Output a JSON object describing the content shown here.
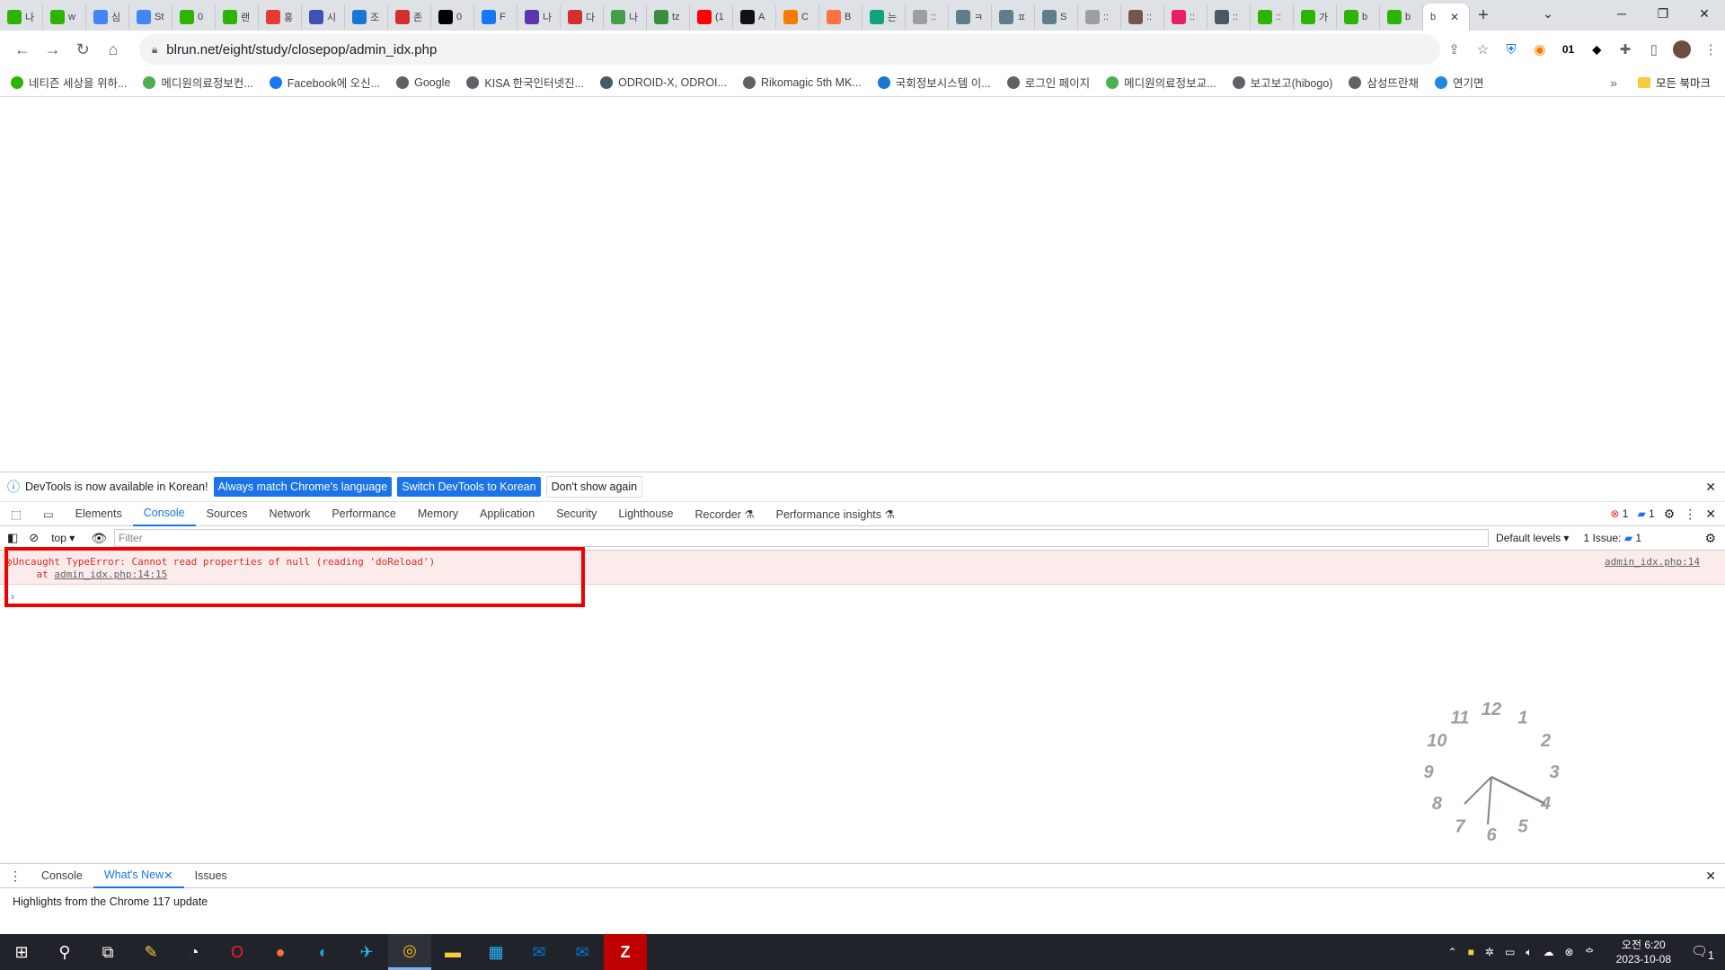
{
  "tabs": [
    {
      "label": "나",
      "icon": "naver-leaf-icon",
      "color": "#2db400"
    },
    {
      "label": "w",
      "icon": "naver-leaf-icon",
      "color": "#2db400"
    },
    {
      "label": "심",
      "icon": "globe-icon",
      "color": "#4285f4"
    },
    {
      "label": "St",
      "icon": "globe-icon",
      "color": "#4285f4"
    },
    {
      "label": "0",
      "icon": "naver-leaf-icon",
      "color": "#2db400"
    },
    {
      "label": "랜",
      "icon": "naver-leaf-icon",
      "color": "#2db400"
    },
    {
      "label": "홍",
      "icon": "n-icon",
      "color": "#e53935"
    },
    {
      "label": "시",
      "icon": "z-icon",
      "color": "#3f51b5"
    },
    {
      "label": "조",
      "icon": "cross-icon",
      "color": "#1976d2"
    },
    {
      "label": "존",
      "icon": "swirl-icon",
      "color": "#d32f2f"
    },
    {
      "label": "0",
      "icon": "x-icon",
      "color": "#000000"
    },
    {
      "label": "F",
      "icon": "facebook-icon",
      "color": "#1877f2"
    },
    {
      "label": "나",
      "icon": "circle-icon",
      "color": "#5e35b1"
    },
    {
      "label": "다",
      "icon": "t-icon",
      "color": "#d32f2f"
    },
    {
      "label": "나",
      "icon": "check-icon",
      "color": "#43a047"
    },
    {
      "label": "tz",
      "icon": "leaf-icon",
      "color": "#388e3c"
    },
    {
      "label": "(1",
      "icon": "youtube-icon",
      "color": "#ff0000"
    },
    {
      "label": "A",
      "icon": "amazon-icon",
      "color": "#111111"
    },
    {
      "label": "C",
      "icon": "cube-icon",
      "color": "#f57c00"
    },
    {
      "label": "B",
      "icon": "b-icon",
      "color": "#ff7043"
    },
    {
      "label": "는",
      "icon": "chatgpt-icon",
      "color": "#10a37f"
    },
    {
      "label": "::",
      "icon": "c-icon",
      "color": "#9e9e9e"
    },
    {
      "label": "ㅋ",
      "icon": "c-icon",
      "color": "#607d8b"
    },
    {
      "label": "ㅍ",
      "icon": "c-icon",
      "color": "#607d8b"
    },
    {
      "label": "S",
      "icon": "wp-icon",
      "color": "#607d8b"
    },
    {
      "label": "::",
      "icon": "gear-icon",
      "color": "#9e9e9e"
    },
    {
      "label": "::",
      "icon": "chrome-icon",
      "color": "#795548"
    },
    {
      "label": "::",
      "icon": "grid-icon",
      "color": "#e91e63"
    },
    {
      "label": "::",
      "icon": "wp-icon",
      "color": "#455a64"
    },
    {
      "label": "::",
      "icon": "naver-leaf-icon",
      "color": "#2db400"
    },
    {
      "label": "가",
      "icon": "naver-leaf-icon",
      "color": "#2db400"
    },
    {
      "label": "b",
      "icon": "naver-leaf-icon",
      "color": "#2db400"
    },
    {
      "label": "b",
      "icon": "naver-leaf-icon",
      "color": "#2db400"
    }
  ],
  "active_tab": {
    "label": "b",
    "close": "✕"
  },
  "window": {
    "chevron": "⌄",
    "minimize": "─",
    "restore": "❐",
    "close": "✕",
    "new_tab": "+"
  },
  "url": "blrun.net/eight/study/closepop/admin_idx.php",
  "bookmarks": [
    {
      "label": "네티즌 세상을 위하...",
      "color": "#2db400"
    },
    {
      "label": "메디원의료정보컨...",
      "color": "#4caf50"
    },
    {
      "label": "Facebook에 오신...",
      "color": "#1877f2"
    },
    {
      "label": "Google",
      "color": "#5f6368"
    },
    {
      "label": "KISA 한국인터넷진...",
      "color": "#5f6368"
    },
    {
      "label": "ODROID-X, ODROI...",
      "color": "#455a64"
    },
    {
      "label": "Rikomagic 5th MK...",
      "color": "#5f6368"
    },
    {
      "label": "국회정보시스템 이...",
      "color": "#1976d2"
    },
    {
      "label": "로그인 페이지",
      "color": "#5f6368"
    },
    {
      "label": "메디원의료정보교...",
      "color": "#4caf50"
    },
    {
      "label": "보고보고(hibogo)",
      "color": "#5f6368"
    },
    {
      "label": "삼성뜨란채",
      "color": "#5f6368"
    },
    {
      "label": "연기면",
      "color": "#1e88e5"
    }
  ],
  "bookmarks_overflow": "»",
  "bookmarks_all": "모든 북마크",
  "infobar": {
    "text": "DevTools is now available in Korean!",
    "btn1": "Always match Chrome's language",
    "btn2": "Switch DevTools to Korean",
    "btn3": "Don't show again"
  },
  "devtools_tabs": [
    "Elements",
    "Console",
    "Sources",
    "Network",
    "Performance",
    "Memory",
    "Application",
    "Security",
    "Lighthouse",
    "Recorder ⚗",
    "Performance insights ⚗"
  ],
  "devtools_active_tab": "Console",
  "errors_count": "1",
  "messages_count": "1",
  "context": "top",
  "filter_placeholder": "Filter",
  "default_levels": "Default levels ▾",
  "issues_label": "1 Issue:",
  "issues_count": "1",
  "error": {
    "line1": "Uncaught TypeError: Cannot read properties of null (reading 'doReload')",
    "line2_prefix": "    at ",
    "line2_link": "admin_idx.php:14:15",
    "source_link": "admin_idx.php:14"
  },
  "prompt": "›",
  "drawer_tabs": [
    {
      "label": "Console"
    },
    {
      "label": "What's New"
    },
    {
      "label": "Issues"
    }
  ],
  "drawer_active": "What's New",
  "drawer_text": "Highlights from the Chrome 117 update",
  "clock_numbers": [
    "12",
    "1",
    "2",
    "3",
    "4",
    "5",
    "6",
    "7",
    "8",
    "9",
    "10",
    "11"
  ],
  "taskbar": {
    "time": "오전 6:20",
    "date": "2023-10-08",
    "notification_count": "1"
  }
}
